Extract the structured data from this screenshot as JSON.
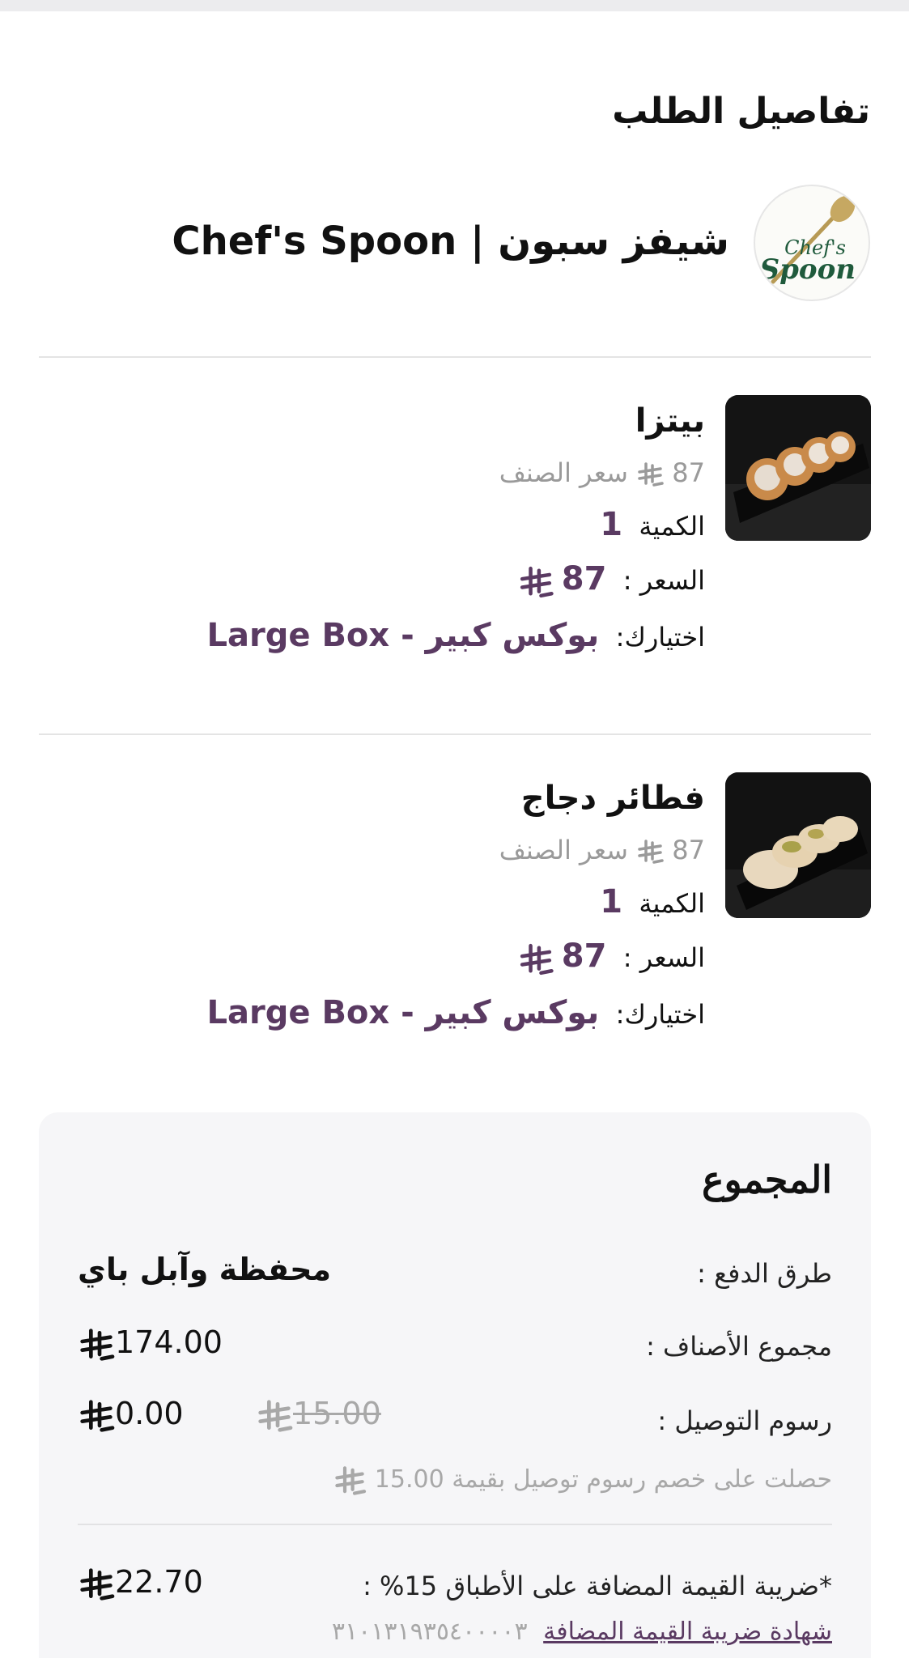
{
  "header": {
    "title": "تفاصيل الطلب"
  },
  "restaurant": {
    "name": "شيفز سبون | Chef's Spoon",
    "logo_text_1": "Chef's",
    "logo_text_2": "Spoon"
  },
  "currency_icon": "sar-riyal-icon",
  "items": [
    {
      "name": "بيتزا",
      "unit_price": "87",
      "unit_price_label": "سعر الصنف",
      "qty_label": "الكمية",
      "qty": "1",
      "price_label": "السعر :",
      "price": "87",
      "option_label": "اختيارك:",
      "option_value": "بوكس كبير - Large Box"
    },
    {
      "name": "فطائر دجاج",
      "unit_price": "87",
      "unit_price_label": "سعر الصنف",
      "qty_label": "الكمية",
      "qty": "1",
      "price_label": "السعر :",
      "price": "87",
      "option_label": "اختيارك:",
      "option_value": "بوكس كبير - Large Box"
    }
  ],
  "summary": {
    "title": "المجموع",
    "payment_label": "طرق الدفع :",
    "payment_value": "محفظة وآبل باي",
    "subtotal_label": "مجموع الأصناف :",
    "subtotal_value": "174.00",
    "delivery_label": "رسوم التوصيل :",
    "delivery_original": "15.00",
    "delivery_value": "0.00",
    "discount_note_prefix": "حصلت على خصم رسوم توصيل بقيمة",
    "discount_note_amount": "15.00",
    "vat_label": "*ضريبة القيمة المضافة على الأطباق 15% :",
    "vat_value": "22.70",
    "vat_cert_label": "شهادة ضريبة القيمة المضافة",
    "vat_cert_number": "٣١٠١٣١٩٣٥٤٠٠٠٠٣"
  },
  "colors": {
    "accent": "#5a3a62",
    "muted": "#9a9a9a",
    "card": "#f6f6f8"
  }
}
